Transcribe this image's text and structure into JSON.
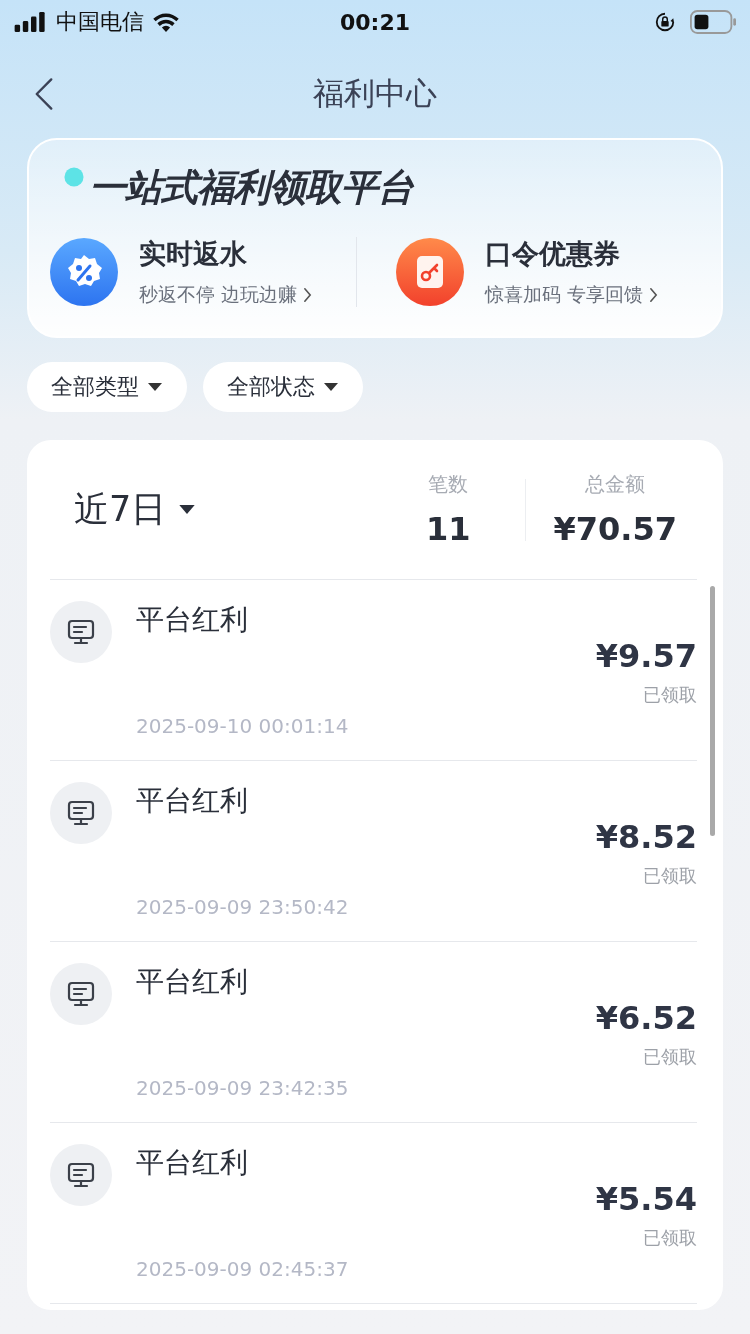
{
  "status_bar": {
    "carrier": "中国电信",
    "time": "00:21"
  },
  "nav": {
    "title": "福利中心"
  },
  "banner": {
    "headline": "一站式福利领取平台",
    "features": [
      {
        "kind": "rebate",
        "title": "实时返水",
        "subtitle": "秒返不停 边玩边赚"
      },
      {
        "kind": "coupon",
        "title": "口令优惠券",
        "subtitle": "惊喜加码 专享回馈"
      }
    ]
  },
  "filters": [
    {
      "label": "全部类型"
    },
    {
      "label": "全部状态"
    }
  ],
  "summary": {
    "period": "近7日",
    "count_label": "笔数",
    "count": "11",
    "total_label": "总金额",
    "total": "¥70.57"
  },
  "records": [
    {
      "title": "平台红利",
      "amount": "¥9.57",
      "status": "已领取",
      "time": "2025-09-10 00:01:14"
    },
    {
      "title": "平台红利",
      "amount": "¥8.52",
      "status": "已领取",
      "time": "2025-09-09 23:50:42"
    },
    {
      "title": "平台红利",
      "amount": "¥6.52",
      "status": "已领取",
      "time": "2025-09-09 23:42:35"
    },
    {
      "title": "平台红利",
      "amount": "¥5.54",
      "status": "已领取",
      "time": "2025-09-09 02:45:37"
    }
  ]
}
